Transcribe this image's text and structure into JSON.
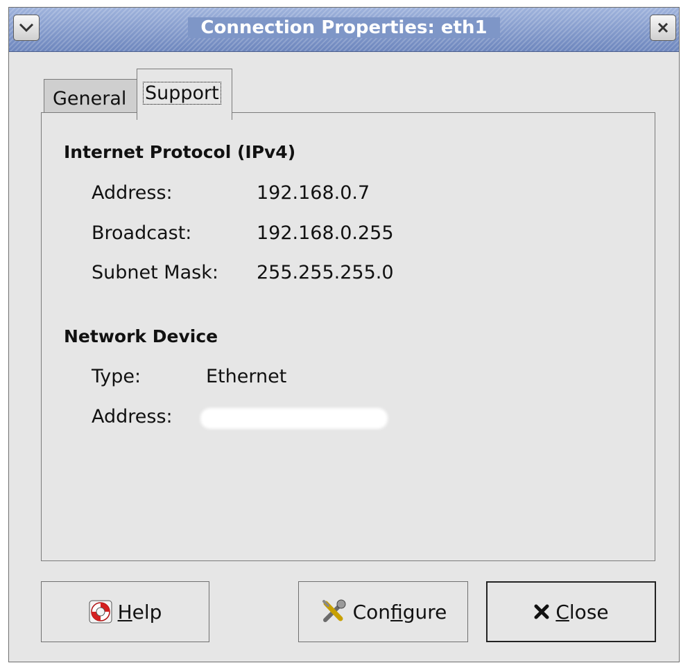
{
  "window": {
    "title": "Connection Properties: eth1",
    "menu_icon": "chevron-down-icon",
    "close_icon": "close-icon"
  },
  "tabs": [
    {
      "label": "General",
      "selected": false
    },
    {
      "label": "Support",
      "selected": true
    }
  ],
  "ipv4": {
    "heading": "Internet Protocol (IPv4)",
    "address_label": "Address:",
    "address_value": "192.168.0.7",
    "broadcast_label": "Broadcast:",
    "broadcast_value": "192.168.0.255",
    "subnet_label": "Subnet Mask:",
    "subnet_value": "255.255.255.0"
  },
  "device": {
    "heading": "Network Device",
    "type_label": "Type:",
    "type_value": "Ethernet",
    "address_label": "Address:"
  },
  "buttons": {
    "help": {
      "prefix": "",
      "mnemonic": "H",
      "suffix": "elp",
      "icon": "lifebuoy-icon"
    },
    "configure": {
      "prefix": "Con",
      "mnemonic": "f",
      "suffix": "igure",
      "icon": "tools-icon"
    },
    "close": {
      "prefix": "",
      "mnemonic": "C",
      "suffix": "lose",
      "icon": "x-icon"
    }
  },
  "colors": {
    "titlebar": "#7e96c7",
    "window_bg": "#e6e6e6"
  }
}
